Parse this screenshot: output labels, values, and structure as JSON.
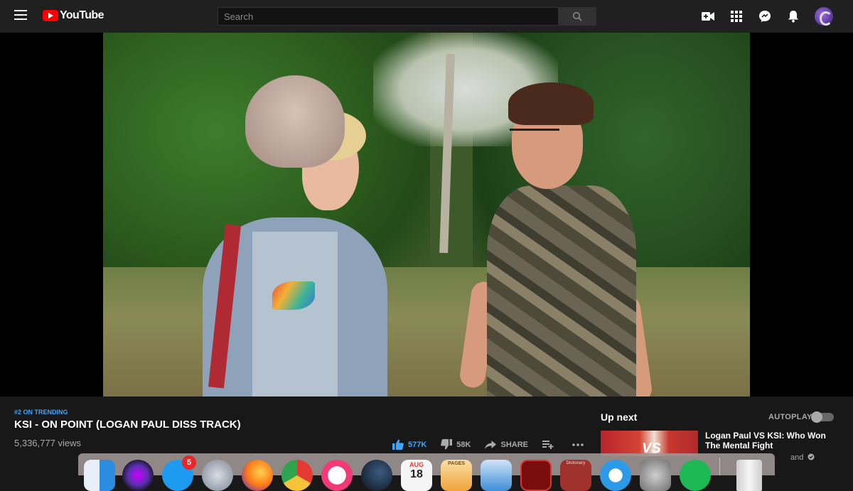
{
  "header": {
    "logo_text": "YouTube",
    "search_placeholder": "Search",
    "icons": [
      "menu-icon",
      "create-video-icon",
      "apps-icon",
      "messages-icon",
      "notifications-icon",
      "account-avatar"
    ]
  },
  "video": {
    "trending_label": "#2 ON TRENDING",
    "title": "KSI - ON POINT (LOGAN PAUL DISS TRACK)",
    "views": "5,336,777 views",
    "likes": "577K",
    "dislikes": "58K",
    "share_label": "SHARE"
  },
  "sidebar": {
    "up_next_label": "Up next",
    "autoplay_label": "AUTOPLAY",
    "autoplay_on": false,
    "recommendation": {
      "title": "Logan Paul VS KSI: Who Won The Mental Fight",
      "thumbnail_text": "VS",
      "channel_partial": "and"
    }
  },
  "dock": {
    "apps": [
      {
        "name": "finder",
        "color": "#2b8de0"
      },
      {
        "name": "siri",
        "color": "#5a2fb0"
      },
      {
        "name": "app-store",
        "color": "#1d9bf0",
        "badge": "5"
      },
      {
        "name": "launchpad",
        "color": "#9aa7b6"
      },
      {
        "name": "firefox",
        "color": "#ff7a18"
      },
      {
        "name": "chrome",
        "color": "#e53a32"
      },
      {
        "name": "itunes",
        "color": "#f33a78"
      },
      {
        "name": "steam",
        "color": "#1b2838"
      },
      {
        "name": "calendar",
        "color": "#f5f5f5",
        "month": "AUG",
        "day": "18"
      },
      {
        "name": "pages",
        "color": "#f1a33a",
        "label": "PAGES"
      },
      {
        "name": "preview",
        "color": "#3f8ed8"
      },
      {
        "name": "acrobat",
        "color": "#7a0e0e"
      },
      {
        "name": "dictionary",
        "color": "#a0302c",
        "label": "Dictionary"
      },
      {
        "name": "safari",
        "color": "#2d9ae8"
      },
      {
        "name": "system-preferences",
        "color": "#8c8c8c"
      },
      {
        "name": "spotify",
        "color": "#1db954"
      },
      {
        "name": "trash",
        "color": "#e6e6e6"
      }
    ]
  }
}
